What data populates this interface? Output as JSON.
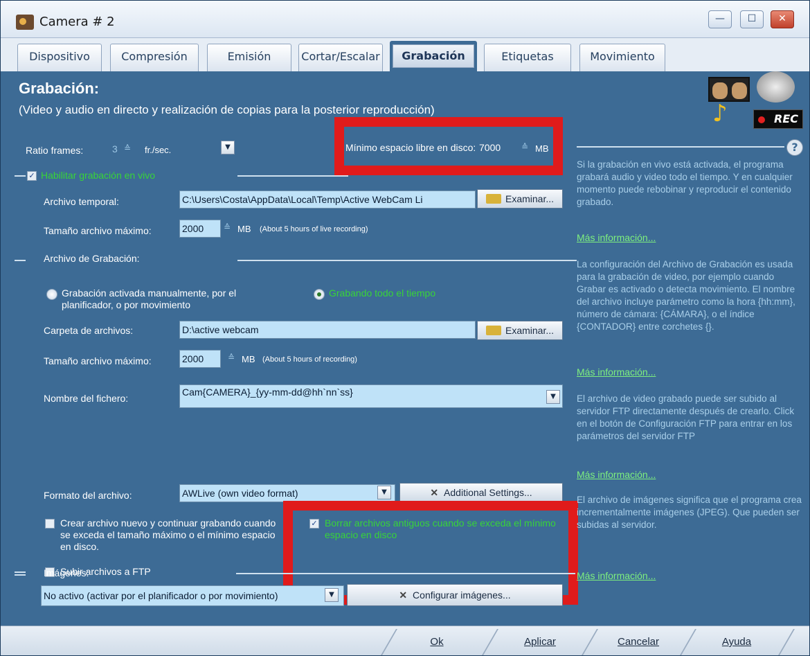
{
  "window": {
    "title": "Camera # 2",
    "controls": {
      "minimize": "—",
      "maximize": "☐",
      "close": "✕"
    }
  },
  "tabs": [
    {
      "label": "Dispositivo"
    },
    {
      "label": "Compresión"
    },
    {
      "label": "Emisión"
    },
    {
      "label": "Cortar/Escalar"
    },
    {
      "label": "Grabación",
      "active": true
    },
    {
      "label": "Etiquetas"
    },
    {
      "label": "Movimiento"
    }
  ],
  "header": {
    "title": "Grabación:",
    "subtitle": "(Video y audio en directo y realización de copias para la posterior reproducción)",
    "rec_badge": "REC"
  },
  "ratio": {
    "label": "Ratio frames:",
    "value": "3",
    "unit": "fr./sec."
  },
  "min_space": {
    "label": "Mínimo espacio libre en disco:",
    "value": "7000",
    "unit": "MB"
  },
  "live": {
    "checkbox_label": "Habilitar grabación en vivo",
    "checked": true,
    "temp_label": "Archivo temporal:",
    "temp_value": "C:\\Users\\Costa\\AppData\\Local\\Temp\\Active WebCam Li",
    "browse": "Examinar...",
    "max_label": "Tamaño archivo máximo:",
    "max_value": "2000",
    "max_unit": "MB",
    "max_note": "(About 5 hours of live recording)"
  },
  "record": {
    "section_label": "Archivo de Grabación:",
    "radio_manual": "Grabación activada manualmente, por el planificador, o por movimiento",
    "radio_always": "Grabando todo el tiempo",
    "folder_label": "Carpeta de archivos:",
    "folder_value": "D:\\active webcam",
    "browse": "Examinar...",
    "max_label": "Tamaño archivo máximo:",
    "max_value": "2000",
    "max_unit": "MB",
    "max_note": "(About 5 hours of recording)",
    "filename_label": "Nombre del fichero:",
    "filename_value": "Cam{CAMERA}_{yy-mm-dd@hh`nn`ss}",
    "format_label": "Formato del archivo:",
    "format_value": "AWLive (own video format)",
    "additional_settings": "Additional Settings...",
    "create_new_label": "Crear archivo nuevo y continuar grabando cuando se exceda el tamaño máximo o el mínimo espacio en disco.",
    "delete_old_label": "Borrar archivos antiguos cuando se exceda el mínimo espacio en disco",
    "ftp_label": "Subir archivos a FTP"
  },
  "images": {
    "section_label": "Imágenes:",
    "select_value": "No activo (activar por el planificador o por movimiento)",
    "configure": "Configurar imágenes..."
  },
  "sidebar": {
    "help": "?",
    "p1": "Si la grabación en vivo está activada, el programa grabará audio y video todo el tiempo. Y en cualquier momento puede rebobinar y reproducir el contenido grabado.",
    "p2": "La configuración del Archivo de Grabación es usada para la grabación de video, por ejemplo cuando Grabar es activado o detecta movimiento. El nombre del archivo incluye parámetro como la hora {hh:mm}, número de cámara: {CÁMARA}, o el índice {CONTADOR} entre corchetes {}.",
    "p3": "El archivo de video grabado puede ser subido al servidor FTP directamente después de crearlo. Click en el botón de Configuración FTP para entrar en los parámetros del servidor FTP",
    "p4": "El archivo de imágenes significa que el programa crea incrementalmente imágenes (JPEG). Que pueden ser subidas al servidor.",
    "more": "Más información..."
  },
  "footer": {
    "ok": "Ok",
    "apply": "Aplicar",
    "cancel": "Cancelar",
    "help": "Ayuda"
  },
  "colors": {
    "panel": "#3d6b95",
    "highlight_box": "#e01b1b",
    "active_text": "#38d438"
  }
}
